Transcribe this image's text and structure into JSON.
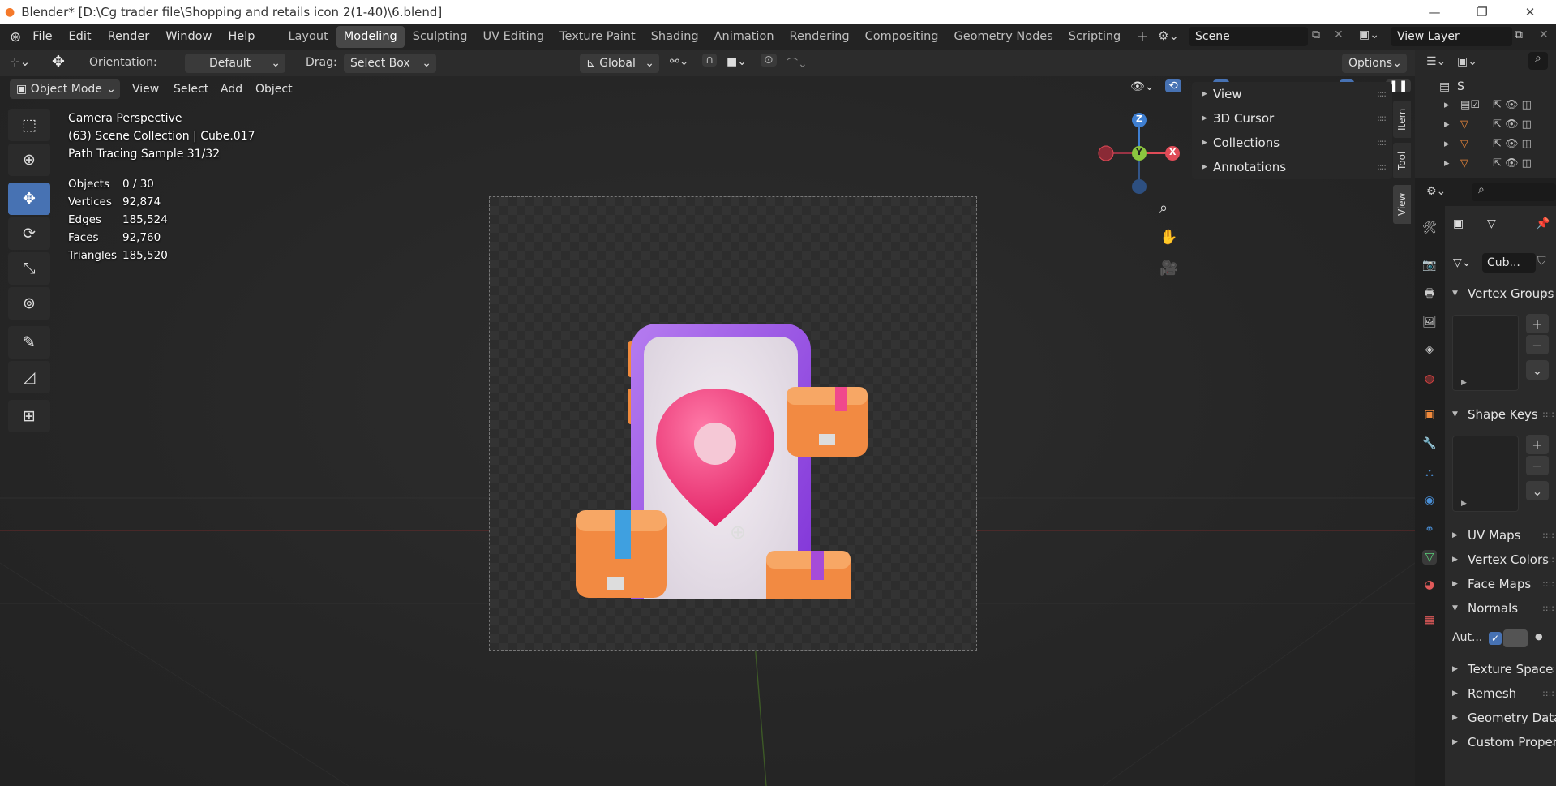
{
  "window": {
    "title": "Blender* [D:\\Cg trader file\\Shopping and retails icon 2(1-40)\\6.blend]",
    "minimize": "—",
    "maximize": "❐",
    "close": "✕"
  },
  "menu": [
    "File",
    "Edit",
    "Render",
    "Window",
    "Help"
  ],
  "workspaces": [
    "Layout",
    "Modeling",
    "Sculpting",
    "UV Editing",
    "Texture Paint",
    "Shading",
    "Animation",
    "Rendering",
    "Compositing",
    "Geometry Nodes",
    "Scripting"
  ],
  "active_workspace": "Modeling",
  "add_workspace": "+",
  "scene": {
    "name": "Scene",
    "view_layer": "View Layer"
  },
  "tool_header": {
    "orientation_label": "Orientation:",
    "orientation_value": "Default",
    "drag_label": "Drag:",
    "drag_value": "Select Box",
    "transform_orientation": "Global",
    "options": "Options"
  },
  "viewport_header": {
    "mode": "Object Mode",
    "menus": [
      "View",
      "Select",
      "Add",
      "Object"
    ]
  },
  "overlay_text": {
    "line1": "Camera Perspective",
    "line2": "(63) Scene Collection | Cube.017",
    "line3": "Path Tracing Sample 31/32"
  },
  "stats": [
    {
      "label": "Objects",
      "value": "0 / 30"
    },
    {
      "label": "Vertices",
      "value": "92,874"
    },
    {
      "label": "Edges",
      "value": "185,524"
    },
    {
      "label": "Faces",
      "value": "92,760"
    },
    {
      "label": "Triangles",
      "value": "185,520"
    }
  ],
  "gizmo": {
    "x": "X",
    "y": "Y",
    "z": "Z"
  },
  "n_panel": {
    "sections": [
      "View",
      "3D Cursor",
      "Collections",
      "Annotations"
    ],
    "tabs": [
      "Item",
      "Tool",
      "View"
    ]
  },
  "outliner": {
    "header": "S"
  },
  "properties": {
    "object_name": "Cub...",
    "sections": [
      {
        "label": "Vertex Groups",
        "open": true
      },
      {
        "label": "Shape Keys",
        "open": true
      },
      {
        "label": "UV Maps",
        "open": false
      },
      {
        "label": "Vertex Colors",
        "open": false
      },
      {
        "label": "Face Maps",
        "open": false
      },
      {
        "label": "Normals",
        "open": true
      },
      {
        "label": "Texture Space",
        "open": false
      },
      {
        "label": "Remesh",
        "open": false
      },
      {
        "label": "Geometry Data",
        "open": false
      },
      {
        "label": "Custom Properties",
        "open": false
      }
    ],
    "auto_smooth_label": "Aut..."
  },
  "colors": {
    "accent": "#4772b3",
    "x_axis": "#e04b57",
    "y_axis": "#8bc53f",
    "z_axis": "#3f7fd1"
  }
}
